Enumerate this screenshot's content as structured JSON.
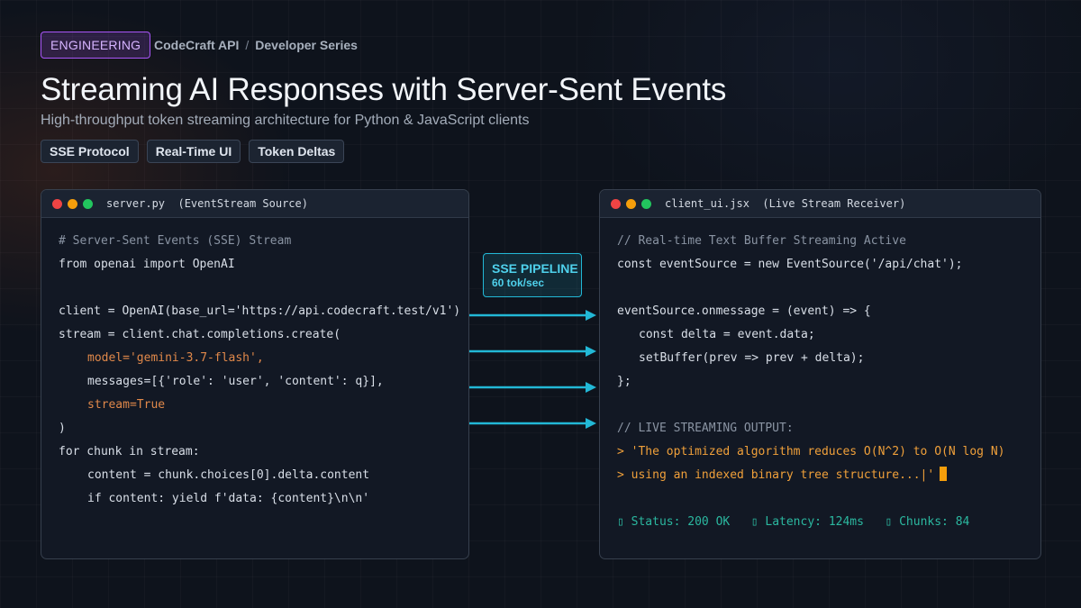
{
  "header": {
    "badge": "ENGINEERING",
    "breadcrumb": [
      "CodeCraft API",
      "/",
      "Developer Series"
    ],
    "title": "Streaming AI Responses with Server-Sent Events",
    "subtitle": "High-throughput token streaming architecture for Python & JavaScript clients",
    "tags": [
      "SSE Protocol",
      "Real-Time UI",
      "Token Deltas"
    ]
  },
  "left_window": {
    "filename": "server.py",
    "caption": "(EventStream Source)",
    "lines": [
      "# Server-Sent Events (SSE) Stream",
      "from openai import OpenAI",
      "",
      "client = OpenAI(base_url='https://api.codecraft.test/v1')",
      "stream = client.chat.completions.create(",
      "model='gemini-3.7-flash',",
      "messages=[{'role': 'user', 'content': q}],",
      "stream=True",
      ")",
      "for chunk in stream:",
      "content = chunk.choices[0].delta.content",
      "if content: yield f'data: {content}\\n\\n'"
    ]
  },
  "pipeline": {
    "label": "SSE PIPELINE",
    "rate": "60 tok/sec"
  },
  "right_window": {
    "filename": "client_ui.jsx",
    "caption": "(Live Stream Receiver)",
    "lines": [
      "// Real-time Text Buffer Streaming Active",
      "const eventSource = new EventSource('/api/chat');",
      "",
      "eventSource.onmessage = (event) => {",
      "const delta = event.data;",
      "setBuffer(prev => prev + delta);",
      "};",
      "",
      "// LIVE STREAMING OUTPUT:",
      "> 'The optimized algorithm reduces O(N^2) to O(N log N)",
      "> using an indexed binary tree structure...|'"
    ],
    "status": {
      "symbol": "▯",
      "status": "Status: 200 OK",
      "latency": "Latency: 124ms",
      "chunks": "Chunks: 84"
    }
  },
  "colors": {
    "accent_purple": "#a855f7",
    "pipeline_cyan": "#22b8d6",
    "stream_orange": "#f0a03a",
    "status_teal": "#2bb8a0"
  }
}
